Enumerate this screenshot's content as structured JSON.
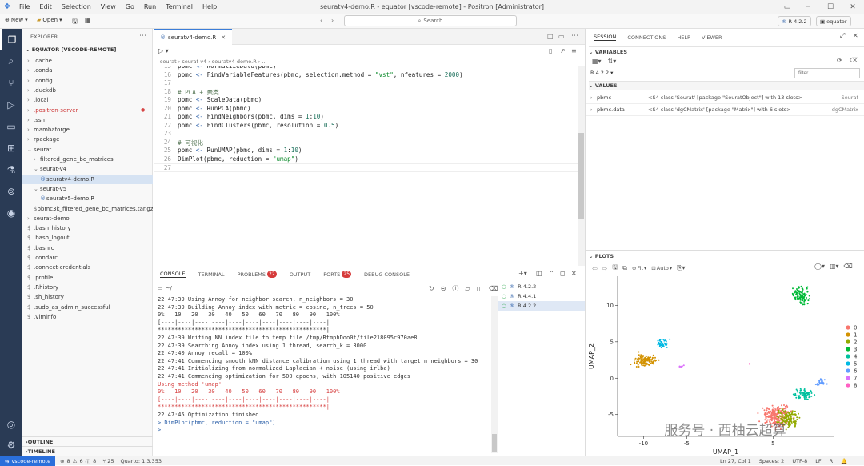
{
  "menubar": {
    "items": [
      "File",
      "Edit",
      "Selection",
      "View",
      "Go",
      "Run",
      "Terminal",
      "Help"
    ],
    "title": "seuratv4-demo.R - equator [vscode-remote] - Positron [Administrator]"
  },
  "toolbar": {
    "new": "New",
    "open": "Open",
    "search_placeholder": "Search",
    "r_version": "R 4.2.2",
    "workspace": "equator"
  },
  "explorer": {
    "header": "EXPLORER",
    "root": "EQUATOR [VSCODE-REMOTE]",
    "items": [
      ".cache",
      ".conda",
      ".config",
      ".duckdb",
      ".local",
      ".positron-server",
      ".ssh",
      "mambaforge",
      "rpackage",
      "seurat",
      "filtered_gene_bc_matrices",
      "seurat-v4",
      "seuratv4-demo.R",
      "seurat-v5",
      "seuratv5-demo.R",
      "pbmc3k_filtered_gene_bc_matrices.tar.gz",
      "seurat-demo",
      ".bash_history",
      ".bash_logout",
      ".bashrc",
      ".condarc",
      ".connect-credentials",
      ".profile",
      ".Rhistory",
      ".sh_history",
      ".sudo_as_admin_successful",
      ".viminfo"
    ],
    "outline": "OUTLINE",
    "timeline": "TIMELINE"
  },
  "editor": {
    "tab": "seuratv4-demo.R",
    "breadcrumb": [
      "seurat",
      "seurat-v4",
      "seuratv4-demo.R",
      "..."
    ],
    "lines": [
      {
        "n": "15",
        "t": "pbmc <- NormalizeData(pbmc)"
      },
      {
        "n": "16",
        "t": "pbmc <- FindVariableFeatures(pbmc, selection.method = \"vst\", nfeatures = 2000)"
      },
      {
        "n": "17",
        "t": ""
      },
      {
        "n": "18",
        "t": "# PCA + 聚类"
      },
      {
        "n": "19",
        "t": "pbmc <- ScaleData(pbmc)"
      },
      {
        "n": "20",
        "t": "pbmc <- RunPCA(pbmc)"
      },
      {
        "n": "21",
        "t": "pbmc <- FindNeighbors(pbmc, dims = 1:10)"
      },
      {
        "n": "22",
        "t": "pbmc <- FindClusters(pbmc, resolution = 0.5)"
      },
      {
        "n": "23",
        "t": ""
      },
      {
        "n": "24",
        "t": "# 可视化"
      },
      {
        "n": "25",
        "t": "pbmc <- RunUMAP(pbmc, dims = 1:10)"
      },
      {
        "n": "26",
        "t": "DimPlot(pbmc, reduction = \"umap\")"
      },
      {
        "n": "27",
        "t": ""
      }
    ]
  },
  "panel": {
    "tabs": [
      "CONSOLE",
      "TERMINAL",
      "PROBLEMS",
      "OUTPUT",
      "PORTS",
      "DEBUG CONSOLE"
    ],
    "problems_count": "22",
    "ports_count": "25",
    "path": "~/",
    "sessions": [
      "R 4.2.2",
      "R 4.4.1",
      "R 4.2.2"
    ],
    "console_lines": [
      {
        "t": "22:47:39 Using Annoy for neighbor search, n_neighbors = 30",
        "c": ""
      },
      {
        "t": "22:47:39 Building Annoy index with metric = cosine, n_trees = 50",
        "c": ""
      },
      {
        "t": "0%   10   20   30   40   50   60   70   80   90   100%",
        "c": ""
      },
      {
        "t": "[----|----|----|----|----|----|----|----|----|----|",
        "c": ""
      },
      {
        "t": "**************************************************|",
        "c": ""
      },
      {
        "t": "22:47:39 Writing NN index file to temp file /tmp/RtmphDoo0t/file218095c970ae8",
        "c": ""
      },
      {
        "t": "22:47:39 Searching Annoy index using 1 thread, search_k = 3000",
        "c": ""
      },
      {
        "t": "22:47:40 Annoy recall = 100%",
        "c": ""
      },
      {
        "t": "22:47:41 Commencing smooth kNN distance calibration using 1 thread with target n_neighbors = 30",
        "c": ""
      },
      {
        "t": "22:47:41 Initializing from normalized Laplacian + noise (using irlba)",
        "c": ""
      },
      {
        "t": "22:47:41 Commencing optimization for 500 epochs, with 105140 positive edges",
        "c": ""
      },
      {
        "t": "Using method 'umap'",
        "c": "red"
      },
      {
        "t": "0%   10   20   30   40   50   60   70   80   90   100%",
        "c": "red"
      },
      {
        "t": "[----|----|----|----|----|----|----|----|----|----|",
        "c": "red"
      },
      {
        "t": "**************************************************|",
        "c": "red"
      },
      {
        "t": "22:47:45 Optimization finished",
        "c": ""
      },
      {
        "t": "> DimPlot(pbmc, reduction = \"umap\")",
        "c": ""
      },
      {
        "t": ">",
        "c": ""
      }
    ]
  },
  "session": {
    "tabs": [
      "SESSION",
      "CONNECTIONS",
      "HELP",
      "VIEWER"
    ],
    "variables_header": "VARIABLES",
    "r_version": "R 4.2.2",
    "filter_placeholder": "filter",
    "values_header": "VALUES",
    "vars": [
      {
        "name": "pbmc",
        "value": "<S4 class 'Seurat' [package \"SeuratObject\"] with 13 slots>",
        "type": "Seurat"
      },
      {
        "name": "pbmc.data",
        "value": "<S4 class 'dgCMatrix' [package \"Matrix\"] with 6 slots>",
        "type": "dgCMatrix"
      }
    ]
  },
  "plots": {
    "header": "PLOTS",
    "fit": "Fit",
    "auto": "Auto",
    "watermark": "服务号 · 西柚云超算"
  },
  "chart_data": {
    "type": "scatter",
    "xlabel": "UMAP_1",
    "ylabel": "UMAP_2",
    "xticks": [
      -10,
      -5,
      5
    ],
    "yticks": [
      10,
      5,
      0,
      -5
    ],
    "legend": {
      "labels": [
        "0",
        "1",
        "2",
        "3",
        "4",
        "5",
        "6",
        "7",
        "8"
      ],
      "colors": [
        "#f8766d",
        "#d39200",
        "#93aa00",
        "#00ba38",
        "#00c19f",
        "#00b9e3",
        "#619cff",
        "#db72fb",
        "#ff61c3"
      ]
    },
    "xlim": [
      -13,
      12
    ],
    "ylim": [
      -8,
      14
    ]
  },
  "status": {
    "remote": "vscode-remote",
    "errors": "8",
    "warnings": "6",
    "info": "8",
    "ports": "25",
    "quarto": "Quarto: 1.3.353",
    "position": "Ln 27, Col 1",
    "spaces": "Spaces: 2",
    "encoding": "UTF-8",
    "eol": "LF",
    "lang": "R"
  }
}
